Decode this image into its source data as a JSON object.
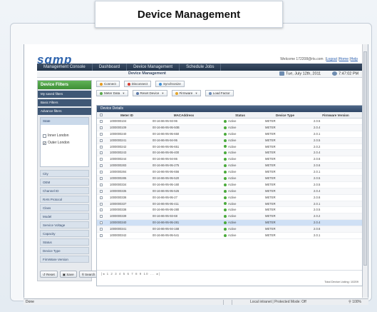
{
  "page_title": "Device Management",
  "app": {
    "logo": "sqmp",
    "welcome_prefix": "Welcome 172208@rts.com",
    "logout": "Logout",
    "home": "Home",
    "help": "Help"
  },
  "nav": [
    "Management Console",
    "Dashboard",
    "Device Management",
    "Schedule Jobs"
  ],
  "subbar": {
    "title": "Device Management",
    "date": "Tue, July 12th, 2011",
    "time": "7:47:02 PM"
  },
  "sidebar": {
    "header": "Device Filters",
    "items": [
      "My saved filters",
      "Basic Filters",
      "Advance filters"
    ],
    "state": {
      "label": "State",
      "options": [
        {
          "label": "Inner London",
          "checked": false
        },
        {
          "label": "Outer London",
          "checked": true
        }
      ]
    },
    "filters": [
      "City",
      "OEM",
      "Channel ID",
      "RAN Protocol",
      "Class",
      "Model",
      "Service Voltage",
      "Capacity",
      "Status",
      "Device Type",
      "FirmWare Version"
    ],
    "actions": [
      "Reset",
      "Save",
      "Search"
    ]
  },
  "toolbar": {
    "row1": [
      "Connect",
      "Disconnect",
      "Synchronize"
    ],
    "row2": [
      "Meter Data",
      "Reset Device",
      "Firmware",
      "Load Factor"
    ]
  },
  "grid": {
    "title": "Device Details",
    "columns": [
      "Meter ID",
      "MACAddress",
      "Status",
      "Device Type",
      "Firmware Version"
    ],
    "rows": [
      [
        "1000000104",
        "00-16-86-95-93-96",
        "Active",
        "METER",
        "2.0.5"
      ],
      [
        "1000000109",
        "00-16-86-95-95-50B",
        "Active",
        "METER",
        "2.0.4"
      ],
      [
        "1000000240",
        "00-16-86-95-95-650",
        "Active",
        "METER",
        "2.0.1"
      ],
      [
        "1000000241",
        "00-16-86-95-94-95",
        "Active",
        "METER",
        "2.0.5"
      ],
      [
        "1000000242",
        "00-16-86-95-95-651",
        "Active",
        "METER",
        "2.0.2"
      ],
      [
        "1000000243",
        "00-16-86-95-95-400",
        "Active",
        "METER",
        "2.0.4"
      ],
      [
        "1000000244",
        "00-16-86-95-94-86",
        "Active",
        "METER",
        "2.0.6"
      ],
      [
        "1000000283",
        "00-16-86-95-95-275",
        "Active",
        "METER",
        "2.0.6"
      ],
      [
        "1000000284",
        "00-16-86-95-95-656",
        "Active",
        "METER",
        "2.0.1"
      ],
      [
        "1000000285",
        "00-16-86-95-95-520",
        "Active",
        "METER",
        "2.0.5"
      ],
      [
        "1000000334",
        "00-16-86-95-95-160",
        "Active",
        "METER",
        "2.0.5"
      ],
      [
        "1000000335",
        "00-16-86-95-95-526",
        "Active",
        "METER",
        "2.0.4"
      ],
      [
        "1000000336",
        "00-16-86-95-95-27",
        "Active",
        "METER",
        "2.0.6"
      ],
      [
        "1000000337",
        "00-16-86-95-95-411",
        "Active",
        "METER",
        "2.0.1"
      ],
      [
        "1000000338",
        "00-16-86-95-95-280",
        "Active",
        "METER",
        "2.0.5"
      ],
      [
        "1000000339",
        "00-16-86-95-93-68",
        "Active",
        "METER",
        "2.0.2"
      ],
      [
        "1000000340",
        "00-16-86-95-95-281",
        "Active",
        "METER",
        "2.0.4"
      ],
      [
        "1000000341",
        "00-16-86-95-94-168",
        "Active",
        "METER",
        "2.0.6"
      ],
      [
        "1000000342",
        "00-16-86-95-95-541",
        "Active",
        "METER",
        "2.0.1"
      ]
    ],
    "selected_row": 16,
    "pager": "|◂ 1 2 3 4 5 6 7 8 9 10 ... ▸|",
    "total": "Total Device Listing: 10209"
  },
  "statusbar": {
    "left": "Done",
    "zone": "Local intranet | Protected Mode: Off",
    "zoom": "100%"
  },
  "colors": {
    "nav": "#2c3e57",
    "accent_green": "#4a9e41",
    "grid_header": "#3e5679",
    "selected": "#cfe0f5"
  }
}
